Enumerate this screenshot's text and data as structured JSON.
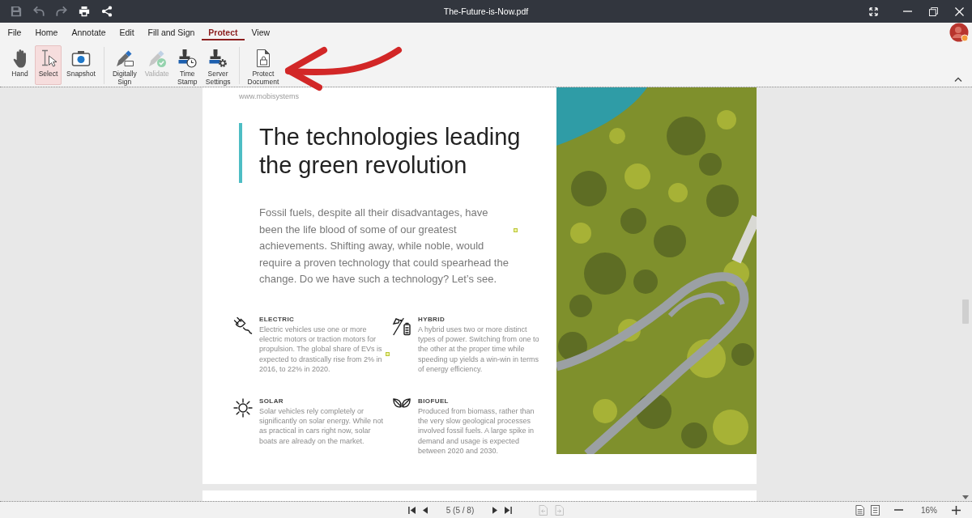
{
  "window": {
    "title": "The-Future-is-Now.pdf"
  },
  "quick_actions": [
    {
      "disabled": true
    },
    {
      "disabled": true
    },
    {
      "disabled": true
    },
    {
      "disabled": false
    },
    {
      "disabled": false
    }
  ],
  "menu": [
    {
      "label": "File",
      "selected": false
    },
    {
      "label": "Home",
      "selected": false
    },
    {
      "label": "Annotate",
      "selected": false
    },
    {
      "label": "Edit",
      "selected": false
    },
    {
      "label": "Fill and Sign",
      "selected": false
    },
    {
      "label": "Protect",
      "selected": true
    },
    {
      "label": "View",
      "selected": false
    }
  ],
  "ribbon": {
    "groups": [
      [
        {
          "label": "Hand",
          "selected": false,
          "disabled": false
        },
        {
          "label": "Select",
          "selected": true,
          "disabled": false
        },
        {
          "label": "Snapshot",
          "selected": false,
          "disabled": false
        }
      ],
      [
        {
          "label": "Digitally Sign",
          "selected": false,
          "disabled": false
        },
        {
          "label": "Validate",
          "selected": false,
          "disabled": true
        },
        {
          "label": "Time Stamp",
          "selected": false,
          "disabled": false
        },
        {
          "label": "Server Settings",
          "selected": false,
          "disabled": false
        }
      ],
      [
        {
          "label": "Protect Document",
          "selected": false,
          "disabled": false
        }
      ]
    ]
  },
  "document": {
    "header": "www.mobisystems",
    "heading": "The technologies leading the green revolution",
    "intro": "Fossil fuels, despite all their disadvantages, have been the life blood of some of our greatest achievements. Shifting away, while noble, would require a proven technology that could spearhead the change. Do we have such a technology? Let’s see.",
    "features": [
      {
        "title": "ELECTRIC",
        "text": "Electric vehicles use one or more electric motors or traction motors for propulsion. The global share of EVs is expected to drastically rise from 2% in 2016, to 22% in 2020."
      },
      {
        "title": "HYBRID",
        "text": "A hybrid uses two or more distinct types of power. Switching from one to the other at the proper time while speeding up yields a win-win in terms of energy efficiency."
      },
      {
        "title": "SOLAR",
        "text": "Solar vehicles rely completely or significantly on solar energy. While not as practical in cars right now, solar boats are already on the market."
      },
      {
        "title": "BIOFUEL",
        "text": "Produced from biomass, rather than the very slow geological processes involved fossil fuels. A large spike in demand and usage is expected between 2020 and 2030."
      }
    ]
  },
  "status_bar": {
    "page": "5 (5 / 8)",
    "history_buttons": [
      {
        "disabled": true
      },
      {
        "disabled": true
      }
    ],
    "zoom": "16%"
  }
}
